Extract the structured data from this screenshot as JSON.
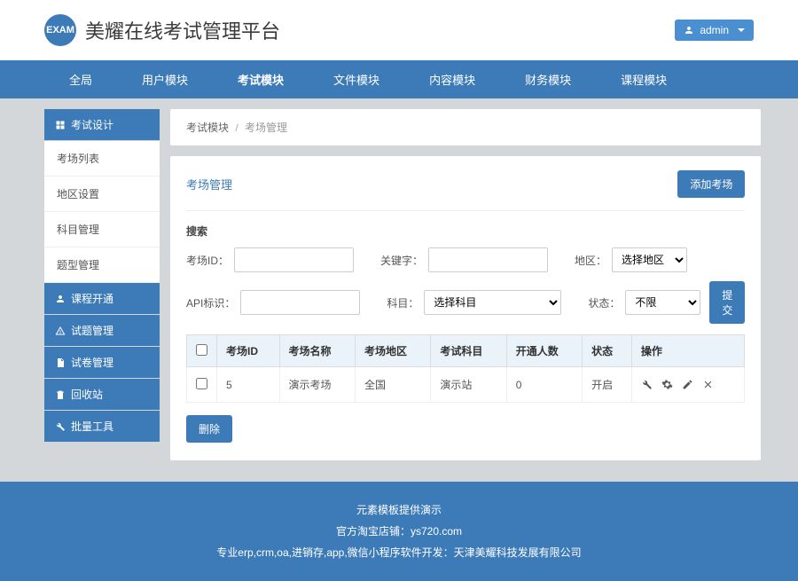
{
  "header": {
    "logo_text": "EXAM",
    "site_title": "美耀在线考试管理平台",
    "user_label": "admin"
  },
  "top_nav": {
    "items": [
      "全局",
      "用户模块",
      "考试模块",
      "文件模块",
      "内容模块",
      "财务模块",
      "课程模块"
    ],
    "active_index": 2
  },
  "sidebar": {
    "sections": [
      {
        "label": "考试设计",
        "items": [
          "考场列表",
          "地区设置",
          "科目管理",
          "题型管理"
        ]
      },
      {
        "label": "课程开通",
        "items": []
      },
      {
        "label": "试题管理",
        "items": []
      },
      {
        "label": "试卷管理",
        "items": []
      },
      {
        "label": "回收站",
        "items": []
      },
      {
        "label": "批量工具",
        "items": []
      }
    ]
  },
  "breadcrumb": {
    "parent": "考试模块",
    "current": "考场管理"
  },
  "panel": {
    "title": "考场管理",
    "add_btn": "添加考场",
    "search_title": "搜索",
    "labels": {
      "room_id": "考场ID：",
      "keyword": "关键字：",
      "region": "地区：",
      "api": "API标识：",
      "subject": "科目：",
      "status": "状态："
    },
    "selects": {
      "region_default": "选择地区",
      "subject_default": "选择科目",
      "status_default": "不限"
    },
    "submit_btn": "提交",
    "delete_btn": "删除"
  },
  "table": {
    "headers": [
      "考场ID",
      "考场名称",
      "考场地区",
      "考试科目",
      "开通人数",
      "状态",
      "操作"
    ],
    "rows": [
      {
        "id": "5",
        "name": "演示考场",
        "region": "全国",
        "subject": "演示站",
        "count": "0",
        "status": "开启"
      }
    ]
  },
  "footer": {
    "line1": "元素模板提供演示",
    "line2": "官方淘宝店铺：ys720.com",
    "line3": "专业erp,crm,oa,进销存,app,微信小程序软件开发：天津美耀科技发展有限公司"
  }
}
